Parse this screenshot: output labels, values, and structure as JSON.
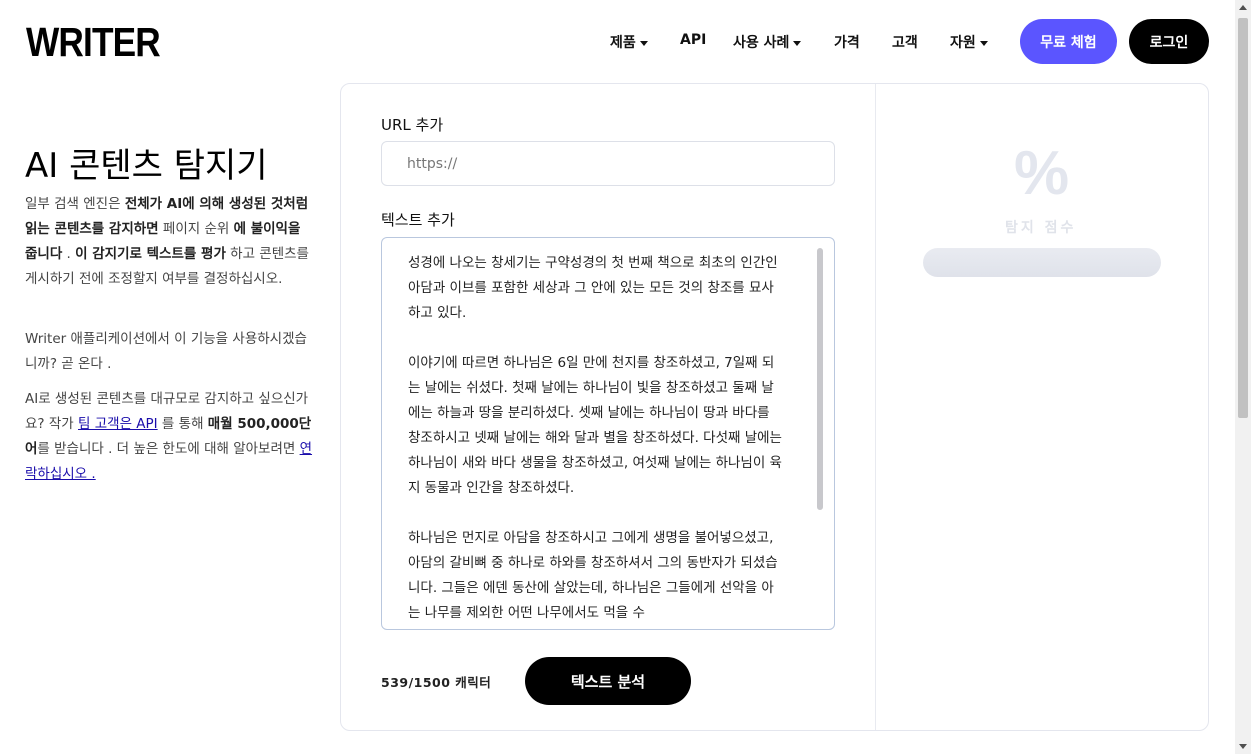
{
  "header": {
    "logo": "WRITER",
    "nav": [
      {
        "label": "제품",
        "dropdown": true
      },
      {
        "label": "API",
        "dropdown": false
      },
      {
        "label": "사용 사례",
        "dropdown": true
      },
      {
        "label": "가격",
        "dropdown": false
      },
      {
        "label": "고객",
        "dropdown": false
      },
      {
        "label": "자원",
        "dropdown": true
      }
    ],
    "trial_button": "무료 체험",
    "login_button": "로그인"
  },
  "left": {
    "title": "AI 콘텐츠 탐지기",
    "p1": {
      "t1": "일부 검색 엔진은 ",
      "b1": "전체가 AI에 의해 생성된 것처럼 읽는 콘텐츠를 감지하면",
      "t2": " 페이지 순위 ",
      "b2": "에 불이익을 줍니다",
      "t3": " . ",
      "b3": "이 감지기로 텍스트를 평가",
      "t4": " 하고 콘텐츠를 게시하기 전에 조정할지 여부를 결정하십시오."
    },
    "p2": "Writer 애플리케이션에서 이 기능을 사용하시겠습니까? 곧 온다 .",
    "p3": {
      "t1": "AI로 생성된 콘텐츠를 대규모로 감지하고 싶으신가요? 작가 ",
      "link1": "팀 고객은 API",
      "t2": " 를 통해 ",
      "b1": "매월 500,000단어",
      "t3": "를 받습니다 . 더 높은 한도에 대해 알아보려면 ",
      "link2": "연락하십시오 ."
    }
  },
  "form": {
    "url_label": "URL 추가",
    "url_placeholder": "https://",
    "text_label": "텍스트 추가",
    "text_paragraphs": [
      "성경에 나오는 창세기는 구약성경의 첫 번째 책으로 최초의 인간인 아담과 이브를 포함한 세상과 그 안에 있는 모든 것의 창조를 묘사하고 있다.",
      "이야기에 따르면 하나님은 6일 만에 천지를 창조하셨고, 7일째 되는 날에는 쉬셨다. 첫째 날에는 하나님이 빛을 창조하셨고 둘째 날에는 하늘과 땅을 분리하셨다. 셋째 날에는 하나님이 땅과 바다를 창조하시고 넷째 날에는 해와 달과 별을 창조하셨다. 다섯째 날에는 하나님이 새와 바다 생물을 창조하셨고, 여섯째 날에는 하나님이 육지 동물과 인간을 창조하셨다.",
      "하나님은 먼지로 아담을 창조하시고 그에게 생명을 불어넣으셨고, 아담의 갈비뼈 중 하나로 하와를 창조하셔서 그의 동반자가 되셨습니다. 그들은 에덴 동산에 살았는데, 하나님은 그들에게 선악을 아는 나무를 제외한 어떤 나무에서도 먹을 수"
    ],
    "char_count": "539/1500 캐릭터",
    "analyze_button": "텍스트 분석"
  },
  "score": {
    "symbol": "%",
    "label": "탐지 점수"
  }
}
